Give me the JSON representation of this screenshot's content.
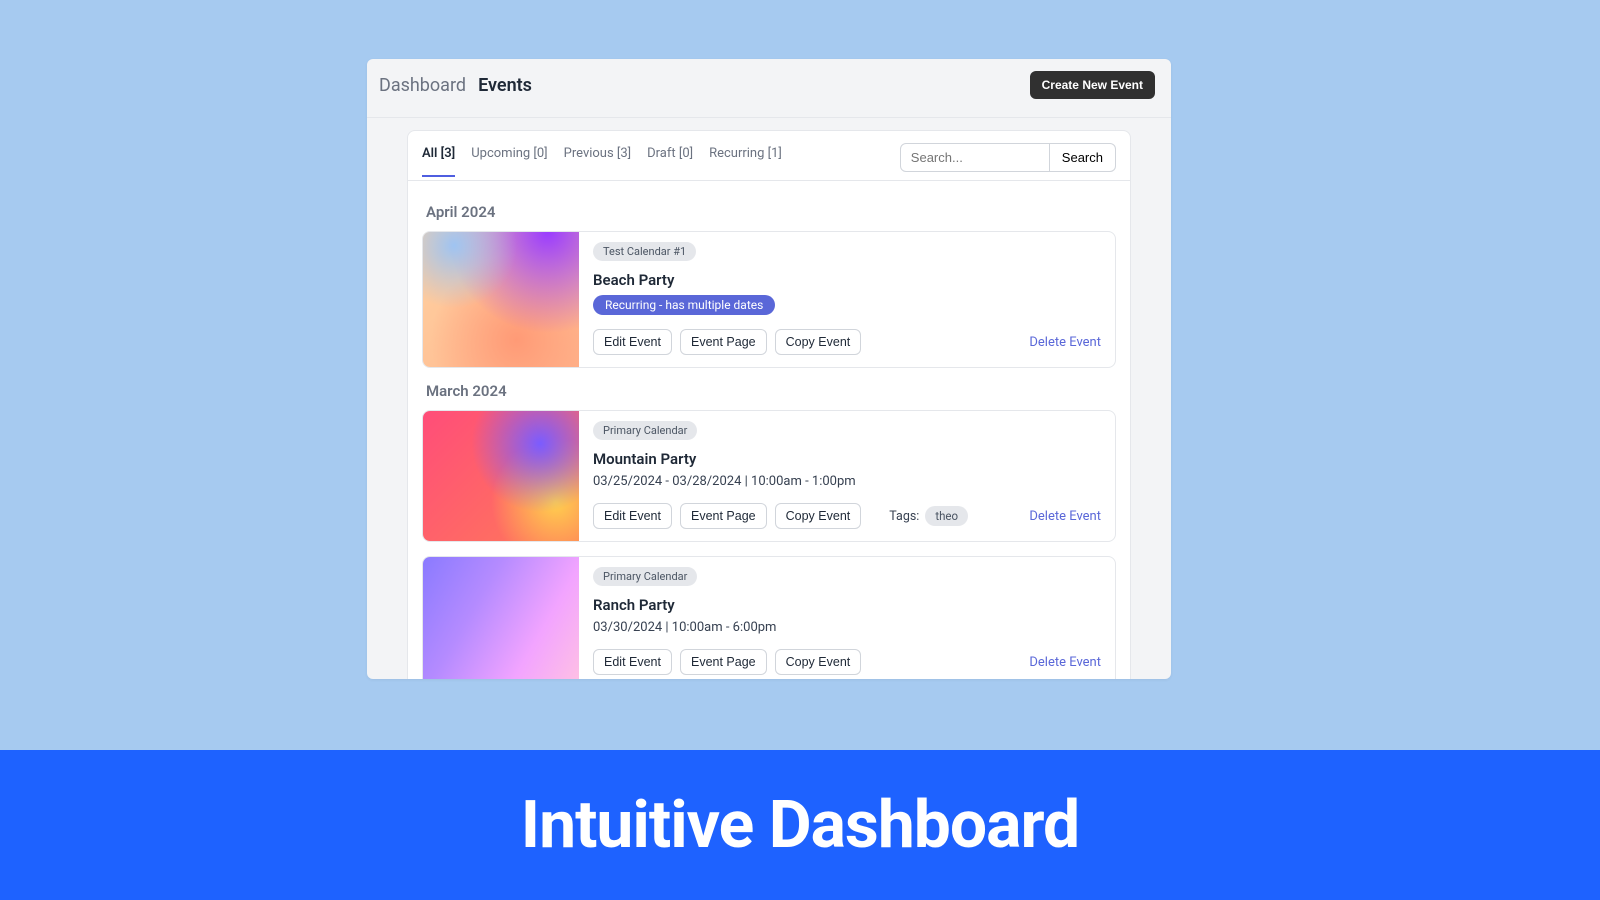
{
  "breadcrumb": {
    "parent": "Dashboard",
    "current": "Events"
  },
  "create_button": "Create New Event",
  "tabs": [
    {
      "label": "All [3]",
      "active": true
    },
    {
      "label": "Upcoming [0]",
      "active": false
    },
    {
      "label": "Previous [3]",
      "active": false
    },
    {
      "label": "Draft [0]",
      "active": false
    },
    {
      "label": "Recurring [1]",
      "active": false
    }
  ],
  "search": {
    "placeholder": "Search...",
    "button": "Search"
  },
  "buttons": {
    "edit": "Edit Event",
    "page": "Event Page",
    "copy": "Copy Event",
    "delete": "Delete Event"
  },
  "tags_label": "Tags:",
  "months": [
    {
      "header": "April 2024",
      "events": [
        {
          "calendar": "Test Calendar #1",
          "title": "Beach Party",
          "recurring": "Recurring - has multiple dates",
          "date": "",
          "tags": [],
          "thumb": "g1"
        }
      ]
    },
    {
      "header": "March 2024",
      "events": [
        {
          "calendar": "Primary Calendar",
          "title": "Mountain Party",
          "recurring": "",
          "date": "03/25/2024 - 03/28/2024 | 10:00am - 1:00pm",
          "tags": [
            "theo"
          ],
          "thumb": "g2"
        },
        {
          "calendar": "Primary Calendar",
          "title": "Ranch Party",
          "recurring": "",
          "date": "03/30/2024 | 10:00am - 6:00pm",
          "tags": [],
          "thumb": "g3"
        }
      ]
    }
  ],
  "hero": "Intuitive Dashboard"
}
